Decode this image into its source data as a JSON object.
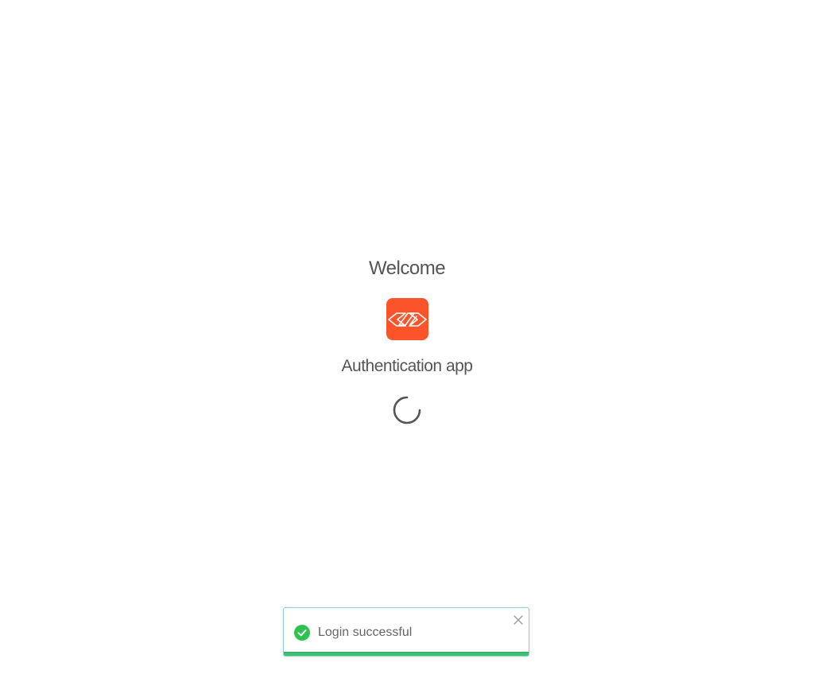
{
  "header": {
    "title": "Welcome"
  },
  "app": {
    "name": "Authentication app",
    "logo_icon": "app-logo-icon",
    "logo_color": "#fb542b"
  },
  "loading": {
    "icon": "loading-spinner-icon"
  },
  "toast": {
    "message": "Login successful",
    "status": "success",
    "status_icon": "check-circle-icon",
    "close_icon": "close-icon",
    "accent_color": "#2ec24e",
    "progress_fraction": 1.0
  }
}
